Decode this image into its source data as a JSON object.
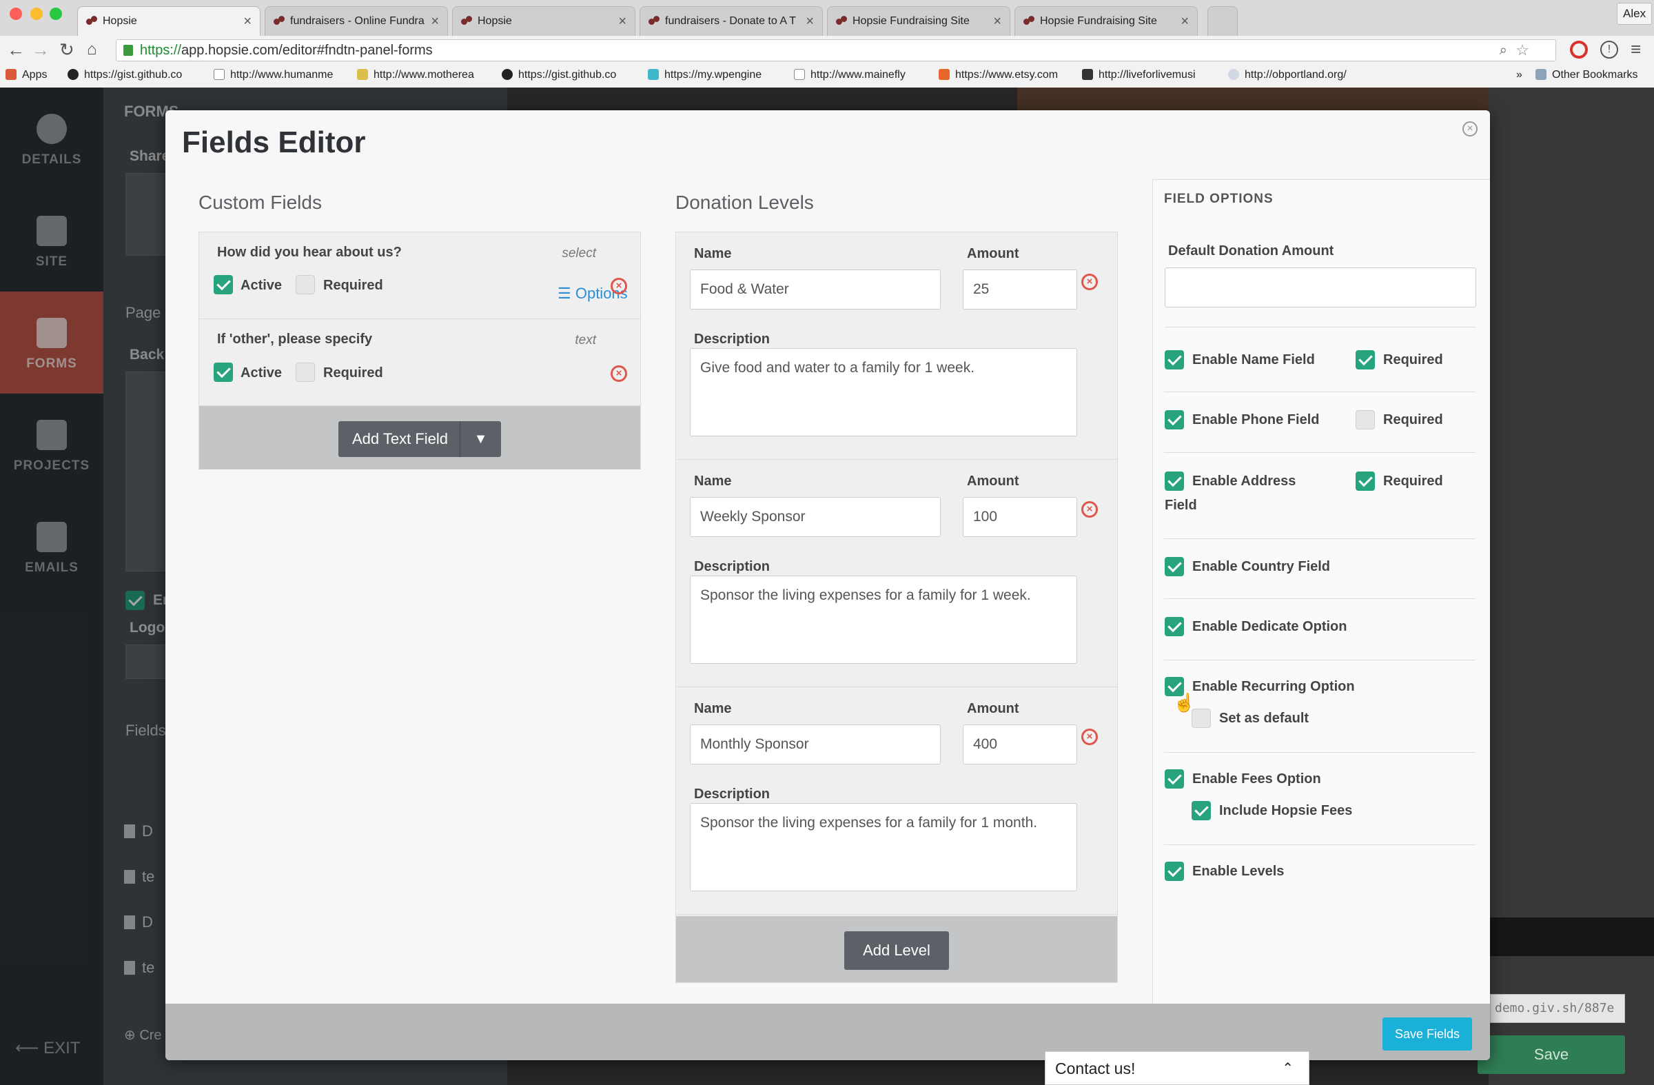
{
  "browser": {
    "tabs": [
      {
        "title": "Hopsie",
        "active": true
      },
      {
        "title": "fundraisers - Online Fundra",
        "active": false
      },
      {
        "title": "Hopsie",
        "active": false
      },
      {
        "title": "fundraisers - Donate to A T",
        "active": false
      },
      {
        "title": "Hopsie Fundraising Site",
        "active": false
      },
      {
        "title": "Hopsie Fundraising Site",
        "active": false
      }
    ],
    "user": "Alex",
    "url_secure": "https://",
    "url_rest": "app.hopsie.com/editor#fndtn-panel-forms",
    "bookmarks": [
      "Apps",
      "https://gist.github.co",
      "http://www.humanme",
      "http://www.motherea",
      "https://gist.github.co",
      "https://my.wpengine",
      "http://www.mainefly",
      "https://www.etsy.com",
      "http://liveforlivemusi",
      "http://obportland.org/"
    ],
    "more_bookmarks": "»",
    "other_bookmarks": "Other Bookmarks"
  },
  "app_sidebar": {
    "items": [
      {
        "label": "DETAILS"
      },
      {
        "label": "SITE"
      },
      {
        "label": "FORMS"
      },
      {
        "label": "PROJECTS"
      },
      {
        "label": "EMAILS"
      }
    ],
    "exit": "⟵ EXIT"
  },
  "modal": {
    "title": "Fields Editor",
    "close_glyph": "×",
    "custom_fields": {
      "heading": "Custom Fields",
      "fields": [
        {
          "question": "How did you hear about us?",
          "type": "select",
          "active_label": "Active",
          "required_label": "Required",
          "active": true,
          "required": false,
          "options_label": "Options"
        },
        {
          "question": "If 'other', please specify",
          "type": "text",
          "active_label": "Active",
          "required_label": "Required",
          "active": true,
          "required": false
        }
      ],
      "add_button": "Add Text Field"
    },
    "donation_levels": {
      "heading": "Donation Levels",
      "name_label": "Name",
      "amount_label": "Amount",
      "description_label": "Description",
      "levels": [
        {
          "name": "Food & Water",
          "amount": "25",
          "description": "Give food and water to a family for 1 week."
        },
        {
          "name": "Weekly Sponsor",
          "amount": "100",
          "description": "Sponsor the living expenses for a family for 1 week."
        },
        {
          "name": "Monthly Sponsor",
          "amount": "400",
          "description": "Sponsor the living expenses for a family for 1 month."
        }
      ],
      "add_button": "Add Level"
    },
    "field_options": {
      "heading": "FIELD OPTIONS",
      "default_amount_label": "Default Donation Amount",
      "default_amount_value": "",
      "options": [
        {
          "label": "Enable Name Field",
          "checked": true,
          "required_label": "Required",
          "required": true
        },
        {
          "label": "Enable Phone Field",
          "checked": true,
          "required_label": "Required",
          "required": false
        },
        {
          "label": "Enable Address",
          "label2": "Field",
          "checked": true,
          "required_label": "Required",
          "required": true
        },
        {
          "label": "Enable Country Field",
          "checked": true
        },
        {
          "label": "Enable Dedicate Option",
          "checked": true
        },
        {
          "label": "Enable Recurring Option",
          "checked": true,
          "sub_label": "Set as default",
          "sub_checked": false
        },
        {
          "label": "Enable Fees Option",
          "checked": true,
          "sub_label": "Include Hopsie Fees",
          "sub_checked": true
        },
        {
          "label": "Enable Levels",
          "checked": true
        }
      ]
    },
    "save_button": "Save Fields"
  },
  "background": {
    "panel_labels": [
      "FORMS",
      "Share",
      "Page",
      "Back",
      "En",
      "Logo",
      "Fields"
    ],
    "form_items": [
      "D",
      "te",
      "D",
      "te"
    ],
    "create_label": "Cre",
    "url_field": "demo.giv.sh/887e",
    "save_button": "Save"
  },
  "contact": {
    "label": "Contact us!",
    "chevron": "⌃"
  },
  "colors": {
    "accent_green": "#27a37e",
    "delete_red": "#e0564a",
    "save_blue": "#1ab0d8",
    "forms_active": "#c0574a"
  }
}
